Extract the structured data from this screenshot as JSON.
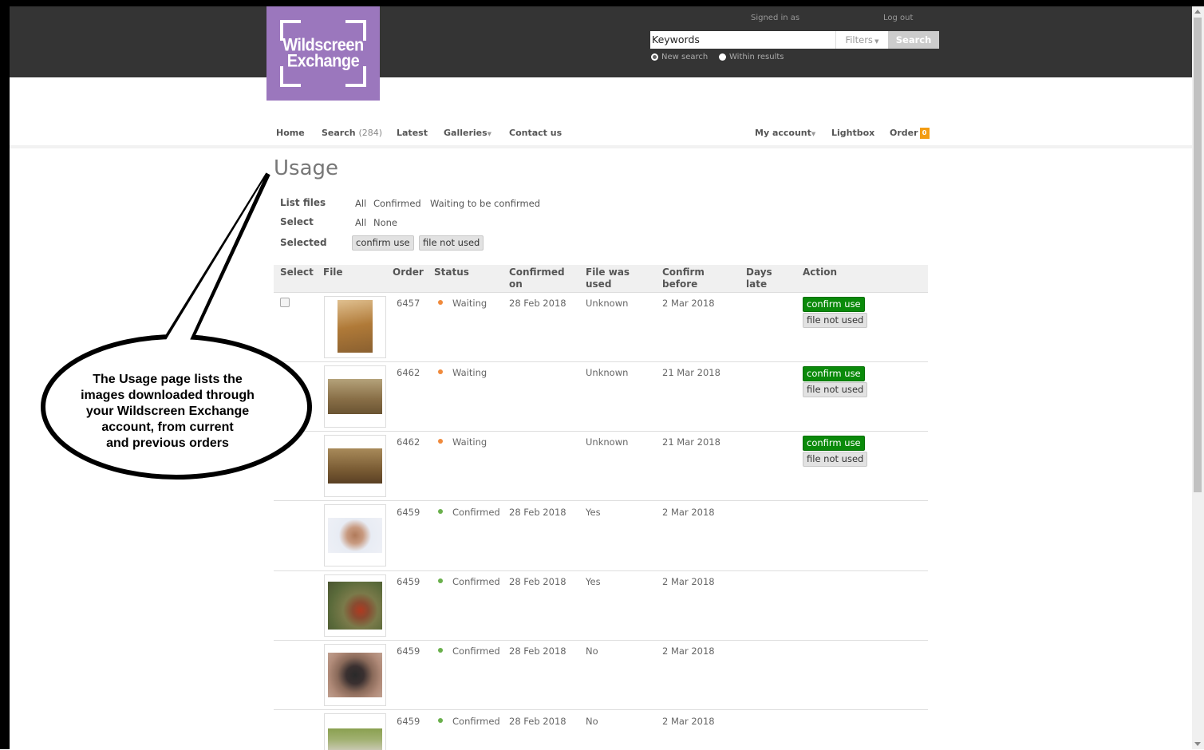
{
  "header": {
    "logo_line1": "Wildscreen",
    "logo_line2": "Exchange",
    "signed_in": "Signed in as",
    "logout": "Log out",
    "search_value": "Keywords",
    "filters_label": "Filters",
    "search_button": "Search",
    "radio_new": "New search",
    "radio_within": "Within results"
  },
  "nav": {
    "home": "Home",
    "search": "Search",
    "search_count": "(284)",
    "latest": "Latest",
    "galleries": "Galleries",
    "contact": "Contact us",
    "my_account": "My account",
    "lightbox": "Lightbox",
    "order": "Order",
    "order_count": "0"
  },
  "page": {
    "title": "Usage",
    "list_files_label": "List files",
    "list_all": "All",
    "list_confirmed": "Confirmed",
    "list_waiting": "Waiting to be confirmed",
    "select_label": "Select",
    "select_all": "All",
    "select_none": "None",
    "selected_label": "Selected",
    "confirm_use": "confirm use",
    "file_not_used": "file not used"
  },
  "table": {
    "headers": {
      "select": "Select",
      "file": "File",
      "order": "Order",
      "status": "Status",
      "confirmed_on_1": "Confirmed",
      "confirmed_on_2": "on",
      "file_was_used_1": "File was",
      "file_was_used_2": "used",
      "confirm_before_1": "Confirm",
      "confirm_before_2": "before",
      "days_late_1": "Days",
      "days_late_2": "late",
      "action": "Action"
    },
    "rows": [
      {
        "order": "6457",
        "status": "Waiting",
        "confirmed_on": "28 Feb 2018",
        "used": "Unknown",
        "before": "2 Mar 2018",
        "confirm": "confirm use",
        "notused": "file not used"
      },
      {
        "order": "6462",
        "status": "Waiting",
        "confirmed_on": "",
        "used": "Unknown",
        "before": "21 Mar 2018",
        "confirm": "confirm use",
        "notused": "file not used"
      },
      {
        "order": "6462",
        "status": "Waiting",
        "confirmed_on": "",
        "used": "Unknown",
        "before": "21 Mar 2018",
        "confirm": "confirm use",
        "notused": "file not used"
      },
      {
        "order": "6459",
        "status": "Confirmed",
        "confirmed_on": "28 Feb 2018",
        "used": "Yes",
        "before": "2 Mar 2018"
      },
      {
        "order": "6459",
        "status": "Confirmed",
        "confirmed_on": "28 Feb 2018",
        "used": "Yes",
        "before": "2 Mar 2018"
      },
      {
        "order": "6459",
        "status": "Confirmed",
        "confirmed_on": "28 Feb 2018",
        "used": "No",
        "before": "2 Mar 2018"
      },
      {
        "order": "6459",
        "status": "Confirmed",
        "confirmed_on": "28 Feb 2018",
        "used": "No",
        "before": "2 Mar 2018"
      }
    ]
  },
  "callout": {
    "line1": "The Usage page lists the",
    "line2": "images downloaded through",
    "line3": "your Wildscreen Exchange",
    "line4": "account, from current",
    "line5": "and previous orders"
  },
  "colors": {
    "header_bg": "#343434",
    "logo_bg": "#9b77bd",
    "confirm_green": "#0a8a0a",
    "waiting_dot": "#f08a3c",
    "confirmed_dot": "#6ab04c",
    "order_badge": "#f39c12"
  }
}
